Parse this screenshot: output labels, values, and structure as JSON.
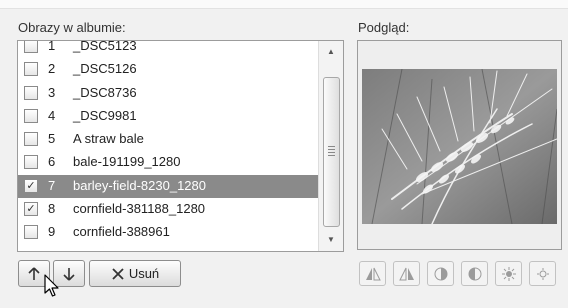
{
  "images_list": {
    "label": "Obrazy w albumie:",
    "items": [
      {
        "number": "1",
        "name": "_DSC5123",
        "checked": false,
        "selected": false
      },
      {
        "number": "2",
        "name": "_DSC5126",
        "checked": false,
        "selected": false
      },
      {
        "number": "3",
        "name": "_DSC8736",
        "checked": false,
        "selected": false
      },
      {
        "number": "4",
        "name": "_DSC9981",
        "checked": false,
        "selected": false
      },
      {
        "number": "5",
        "name": "A straw bale",
        "checked": false,
        "selected": false
      },
      {
        "number": "6",
        "name": "bale-191199_1280",
        "checked": false,
        "selected": false
      },
      {
        "number": "7",
        "name": "barley-field-8230_1280",
        "checked": true,
        "selected": true
      },
      {
        "number": "8",
        "name": "cornfield-381188_1280",
        "checked": true,
        "selected": false
      },
      {
        "number": "9",
        "name": "cornfield-388961",
        "checked": false,
        "selected": false
      }
    ]
  },
  "buttons": {
    "move_up_icon": "arrow-up-icon",
    "move_down_icon": "arrow-down-icon",
    "remove_label": "Usuń",
    "remove_icon": "x-icon"
  },
  "preview": {
    "label": "Podgląd:",
    "image": "barley-ears-photo",
    "tools": [
      {
        "icon": "rotate-left-icon",
        "enabled": false
      },
      {
        "icon": "rotate-right-icon",
        "enabled": false
      },
      {
        "icon": "contrast-increase-icon",
        "enabled": false
      },
      {
        "icon": "contrast-decrease-icon",
        "enabled": false
      },
      {
        "icon": "brightness-increase-icon",
        "enabled": false
      },
      {
        "icon": "brightness-decrease-icon",
        "enabled": false
      }
    ]
  },
  "colors": {
    "selected_row": "#8a8a8a",
    "background": "#f1f1f1"
  }
}
